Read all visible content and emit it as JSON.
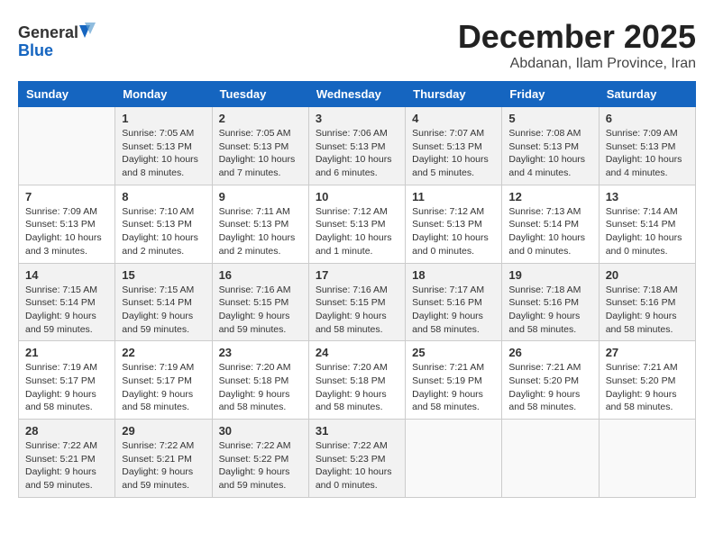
{
  "header": {
    "logo_line1": "General",
    "logo_line2": "Blue",
    "month_year": "December 2025",
    "location": "Abdanan, Ilam Province, Iran"
  },
  "weekdays": [
    "Sunday",
    "Monday",
    "Tuesday",
    "Wednesday",
    "Thursday",
    "Friday",
    "Saturday"
  ],
  "weeks": [
    [
      {
        "day": "",
        "info": ""
      },
      {
        "day": "1",
        "info": "Sunrise: 7:05 AM\nSunset: 5:13 PM\nDaylight: 10 hours\nand 8 minutes."
      },
      {
        "day": "2",
        "info": "Sunrise: 7:05 AM\nSunset: 5:13 PM\nDaylight: 10 hours\nand 7 minutes."
      },
      {
        "day": "3",
        "info": "Sunrise: 7:06 AM\nSunset: 5:13 PM\nDaylight: 10 hours\nand 6 minutes."
      },
      {
        "day": "4",
        "info": "Sunrise: 7:07 AM\nSunset: 5:13 PM\nDaylight: 10 hours\nand 5 minutes."
      },
      {
        "day": "5",
        "info": "Sunrise: 7:08 AM\nSunset: 5:13 PM\nDaylight: 10 hours\nand 4 minutes."
      },
      {
        "day": "6",
        "info": "Sunrise: 7:09 AM\nSunset: 5:13 PM\nDaylight: 10 hours\nand 4 minutes."
      }
    ],
    [
      {
        "day": "7",
        "info": "Sunrise: 7:09 AM\nSunset: 5:13 PM\nDaylight: 10 hours\nand 3 minutes."
      },
      {
        "day": "8",
        "info": "Sunrise: 7:10 AM\nSunset: 5:13 PM\nDaylight: 10 hours\nand 2 minutes."
      },
      {
        "day": "9",
        "info": "Sunrise: 7:11 AM\nSunset: 5:13 PM\nDaylight: 10 hours\nand 2 minutes."
      },
      {
        "day": "10",
        "info": "Sunrise: 7:12 AM\nSunset: 5:13 PM\nDaylight: 10 hours\nand 1 minute."
      },
      {
        "day": "11",
        "info": "Sunrise: 7:12 AM\nSunset: 5:13 PM\nDaylight: 10 hours\nand 0 minutes."
      },
      {
        "day": "12",
        "info": "Sunrise: 7:13 AM\nSunset: 5:14 PM\nDaylight: 10 hours\nand 0 minutes."
      },
      {
        "day": "13",
        "info": "Sunrise: 7:14 AM\nSunset: 5:14 PM\nDaylight: 10 hours\nand 0 minutes."
      }
    ],
    [
      {
        "day": "14",
        "info": "Sunrise: 7:15 AM\nSunset: 5:14 PM\nDaylight: 9 hours\nand 59 minutes."
      },
      {
        "day": "15",
        "info": "Sunrise: 7:15 AM\nSunset: 5:14 PM\nDaylight: 9 hours\nand 59 minutes."
      },
      {
        "day": "16",
        "info": "Sunrise: 7:16 AM\nSunset: 5:15 PM\nDaylight: 9 hours\nand 59 minutes."
      },
      {
        "day": "17",
        "info": "Sunrise: 7:16 AM\nSunset: 5:15 PM\nDaylight: 9 hours\nand 58 minutes."
      },
      {
        "day": "18",
        "info": "Sunrise: 7:17 AM\nSunset: 5:16 PM\nDaylight: 9 hours\nand 58 minutes."
      },
      {
        "day": "19",
        "info": "Sunrise: 7:18 AM\nSunset: 5:16 PM\nDaylight: 9 hours\nand 58 minutes."
      },
      {
        "day": "20",
        "info": "Sunrise: 7:18 AM\nSunset: 5:16 PM\nDaylight: 9 hours\nand 58 minutes."
      }
    ],
    [
      {
        "day": "21",
        "info": "Sunrise: 7:19 AM\nSunset: 5:17 PM\nDaylight: 9 hours\nand 58 minutes."
      },
      {
        "day": "22",
        "info": "Sunrise: 7:19 AM\nSunset: 5:17 PM\nDaylight: 9 hours\nand 58 minutes."
      },
      {
        "day": "23",
        "info": "Sunrise: 7:20 AM\nSunset: 5:18 PM\nDaylight: 9 hours\nand 58 minutes."
      },
      {
        "day": "24",
        "info": "Sunrise: 7:20 AM\nSunset: 5:18 PM\nDaylight: 9 hours\nand 58 minutes."
      },
      {
        "day": "25",
        "info": "Sunrise: 7:21 AM\nSunset: 5:19 PM\nDaylight: 9 hours\nand 58 minutes."
      },
      {
        "day": "26",
        "info": "Sunrise: 7:21 AM\nSunset: 5:20 PM\nDaylight: 9 hours\nand 58 minutes."
      },
      {
        "day": "27",
        "info": "Sunrise: 7:21 AM\nSunset: 5:20 PM\nDaylight: 9 hours\nand 58 minutes."
      }
    ],
    [
      {
        "day": "28",
        "info": "Sunrise: 7:22 AM\nSunset: 5:21 PM\nDaylight: 9 hours\nand 59 minutes."
      },
      {
        "day": "29",
        "info": "Sunrise: 7:22 AM\nSunset: 5:21 PM\nDaylight: 9 hours\nand 59 minutes."
      },
      {
        "day": "30",
        "info": "Sunrise: 7:22 AM\nSunset: 5:22 PM\nDaylight: 9 hours\nand 59 minutes."
      },
      {
        "day": "31",
        "info": "Sunrise: 7:22 AM\nSunset: 5:23 PM\nDaylight: 10 hours\nand 0 minutes."
      },
      {
        "day": "",
        "info": ""
      },
      {
        "day": "",
        "info": ""
      },
      {
        "day": "",
        "info": ""
      }
    ]
  ]
}
